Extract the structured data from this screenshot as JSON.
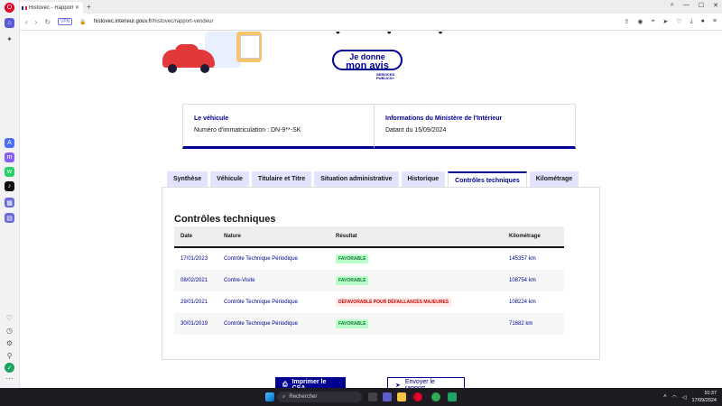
{
  "browser": {
    "tab_title": "Histovec - Rapport vendeur",
    "url_prefix": "histovec.interieur.gouv.fr",
    "url_path": "/histovec/rapport-vendeur",
    "vpn_label": "VPN"
  },
  "hero": {
    "avis_line1": "Je donne",
    "avis_line2": "mon avis",
    "services_publics_line1": "SERVICES",
    "services_publics_line2": "PUBLICS+"
  },
  "cards": {
    "vehicule_title": "Le véhicule",
    "vehicule_value": "Numéro d'immatriculation : DN-9**-SK",
    "ministere_title": "Informations du Ministère de l'Intérieur",
    "ministere_value": "Datant du 15/09/2024"
  },
  "tabs": [
    "Synthèse",
    "Véhicule",
    "Titulaire et Titre",
    "Situation administrative",
    "Historique",
    "Contrôles techniques",
    "Kilométrage"
  ],
  "active_tab": "Contrôles techniques",
  "controles": {
    "title": "Contrôles techniques",
    "headers": {
      "date": "Date",
      "nature": "Nature",
      "resultat": "Résultat",
      "km": "Kilométrage"
    },
    "rows": [
      {
        "date": "17/01/2023",
        "nature": "Contrôle Technique Périodique",
        "resultat": "FAVORABLE",
        "status": "ok",
        "km": "145357 km"
      },
      {
        "date": "08/02/2021",
        "nature": "Contre-Visite",
        "resultat": "FAVORABLE",
        "status": "ok",
        "km": "108754 km"
      },
      {
        "date": "29/01/2021",
        "nature": "Contrôle Technique Périodique",
        "resultat": "DÉFAVORABLE POUR DÉFAILLANCES MAJEURES",
        "status": "bad",
        "km": "108224 km"
      },
      {
        "date": "30/01/2019",
        "nature": "Contrôle Technique Périodique",
        "resultat": "FAVORABLE",
        "status": "ok",
        "km": "71682 km"
      }
    ]
  },
  "buttons": {
    "print": "Imprimer le CSA",
    "send": "Envoyer le rapport"
  },
  "taskbar": {
    "search_placeholder": "Rechercher",
    "time": "10:37",
    "date": "17/09/2024"
  },
  "colors": {
    "primary": "#000091",
    "ok_bg": "#b8fec9",
    "bad_bg": "#ffe9e9"
  }
}
